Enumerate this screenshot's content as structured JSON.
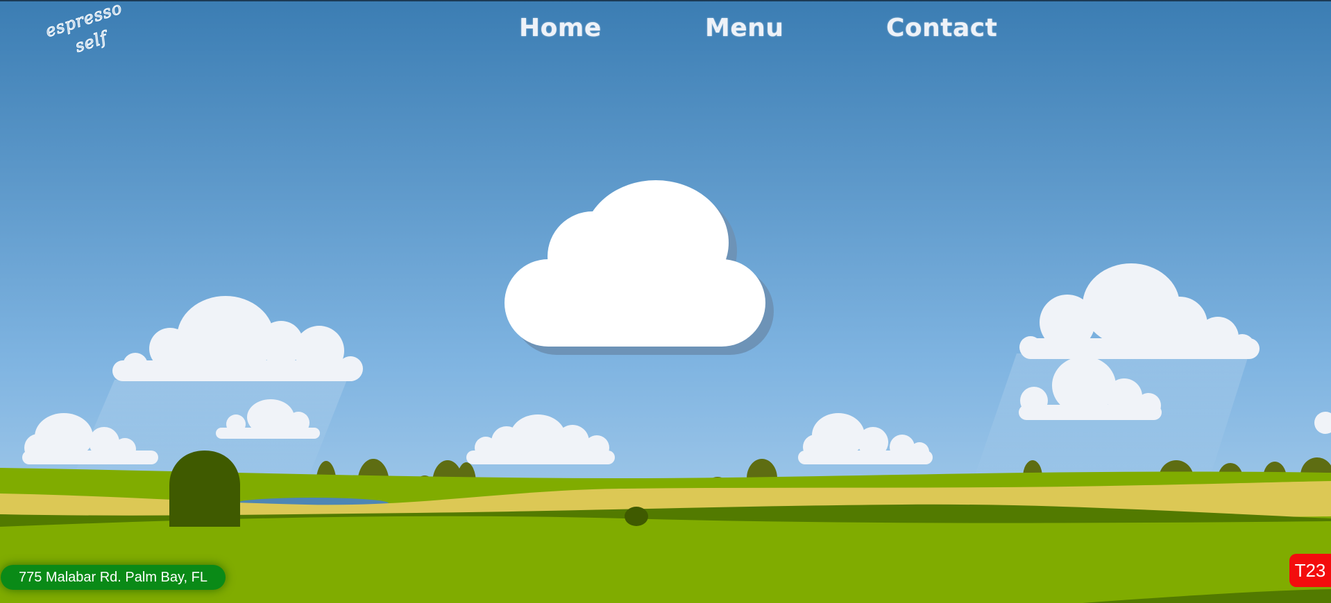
{
  "logo": {
    "line1": "espresso",
    "line2": "self"
  },
  "nav": {
    "items": [
      {
        "label": "Home"
      },
      {
        "label": "Menu"
      },
      {
        "label": "Contact"
      }
    ]
  },
  "footer": {
    "address": "775 Malabar Rd. Palm Bay, FL",
    "badge": "T23"
  },
  "colors": {
    "sky_top": "#3b7db3",
    "sky_bottom": "#a9cdeb",
    "grass": "#80ac00",
    "dark_grass": "#527a00",
    "sand": "#dcc855",
    "tree": "#3f5a00",
    "tree_light": "#5e6d12",
    "address_bg": "#0a8a17",
    "badge_bg": "#f30d0d"
  }
}
